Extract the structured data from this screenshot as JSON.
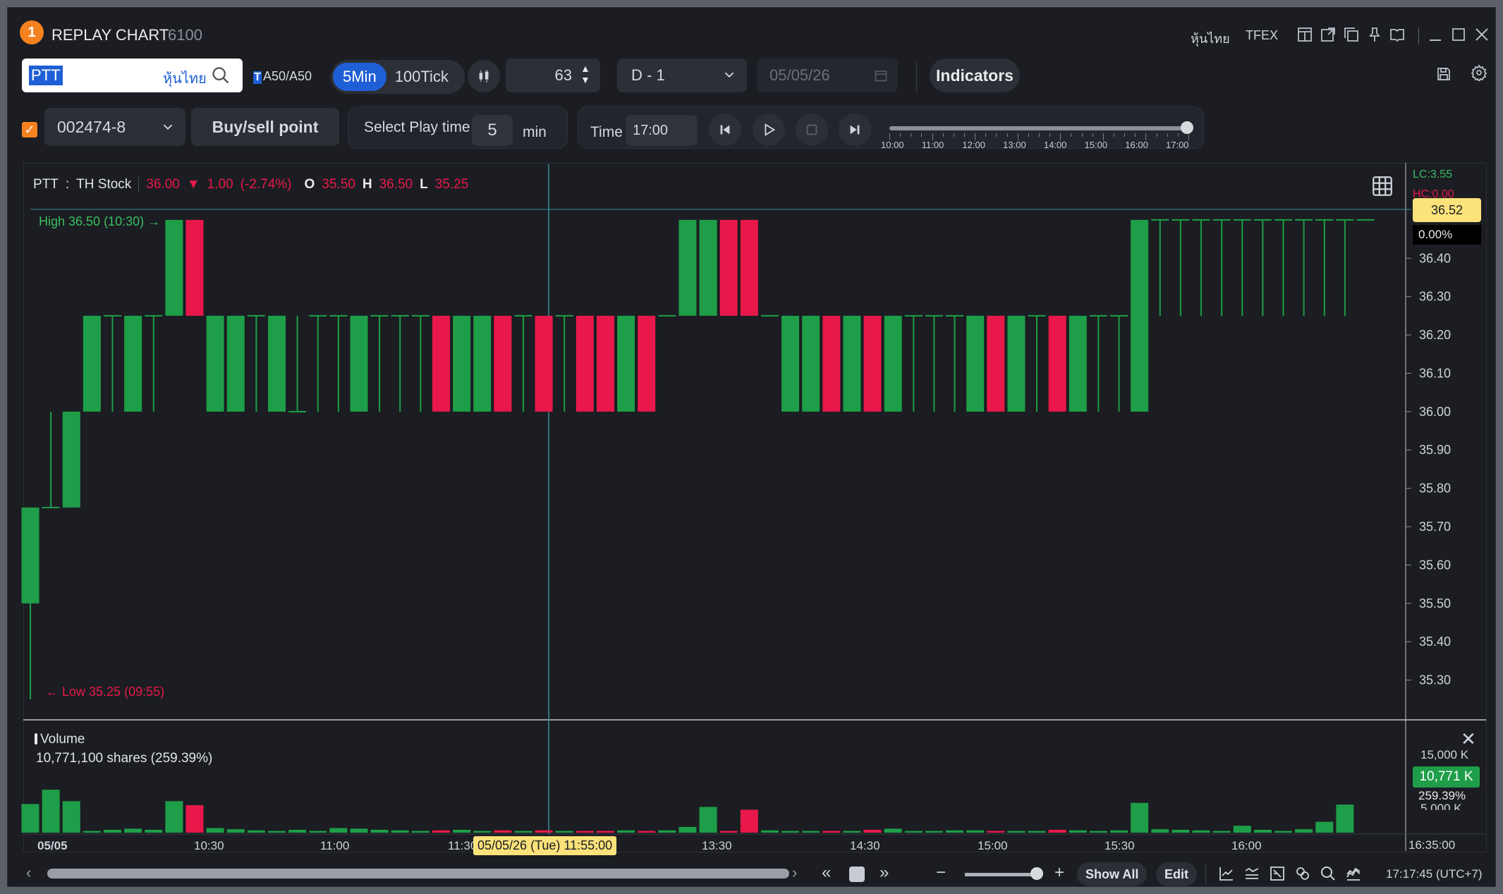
{
  "window": {
    "badge": "1",
    "title": "REPLAY CHART",
    "code": "6100",
    "links": [
      "หุ้นไทย",
      "TFEX"
    ]
  },
  "toolbar": {
    "search_value": "PTT",
    "market": "หุ้นไทย",
    "tag_t": "T",
    "tag_text": "A50/A50",
    "interval_active": "5Min",
    "interval_other": "100Tick",
    "count": "63",
    "day": "D - 1",
    "date": "05/05/26",
    "indicators": "Indicators"
  },
  "row2": {
    "account": "002474-8",
    "buy_sell": "Buy/sell point",
    "play_label": "Select Play time",
    "play_value": "5",
    "play_unit": "min",
    "time_label": "Time",
    "time_value": "17:00",
    "slider_value": "17:00",
    "slider_labels": [
      "10:00",
      "11:00",
      "12:00",
      "13:00",
      "14:00",
      "15:00",
      "16:00",
      "17:00"
    ]
  },
  "info": {
    "symbol": "PTT",
    "colon": ":",
    "market": "TH Stock",
    "last": "36.00",
    "arrow": "▼",
    "change": "1.00",
    "pct": "(-2.74%)",
    "o_label": "O",
    "o": "35.50",
    "h_label": "H",
    "h": "36.50",
    "l_label": "L",
    "l": "35.25"
  },
  "price_panel": {
    "lc": "LC:3.55",
    "hc": "HC:0.00",
    "last_price": "36.52",
    "pct": "0.00%",
    "high_label": "High 36.50 (10:30)",
    "low_label": "Low 35.25 (09:55)",
    "y_ticks": [
      "36.40",
      "36.30",
      "36.20",
      "36.10",
      "36.00",
      "35.90",
      "35.80",
      "35.70",
      "35.60",
      "35.50",
      "35.40",
      "35.30"
    ]
  },
  "volume_panel": {
    "title": "Volume",
    "line": "10,771,100 shares (259.39%)",
    "y_tick": "15,000 K",
    "y_tick_partial": "5,000 K",
    "badge": "10,771 K",
    "pct": "259.39%",
    "close": "✕"
  },
  "x_axis": {
    "labels": [
      "05/05",
      "10:30",
      "11:00",
      "11:30",
      "13:30",
      "14:30",
      "15:00",
      "15:30",
      "16:00"
    ],
    "tooltip": "05/05/26 (Tue) 11:55:00",
    "right_label": "16:35:00"
  },
  "bottombar": {
    "prev": "«",
    "next": "»",
    "minus": "−",
    "plus": "+",
    "show_all": "Show All",
    "edit": "Edit",
    "clock": "17:17:45 (UTC+7)"
  },
  "colors": {
    "up": "#1e9e48",
    "down": "#e8194a",
    "accent": "#1f5fd6",
    "badge": "#f58220",
    "highlight": "#fbe27a"
  },
  "chart_data": {
    "type": "candlestick",
    "ylim": [
      35.2,
      36.52
    ],
    "candles": [
      {
        "t": "09:55",
        "o": 35.5,
        "h": 35.75,
        "l": 35.25,
        "c": 35.75
      },
      {
        "t": "10:00",
        "o": 35.75,
        "h": 36.0,
        "l": 35.75,
        "c": 35.75
      },
      {
        "t": "10:05",
        "o": 35.75,
        "h": 36.0,
        "l": 35.75,
        "c": 36.0
      },
      {
        "t": "10:10",
        "o": 36.0,
        "h": 36.25,
        "l": 36.0,
        "c": 36.25
      },
      {
        "t": "10:15",
        "o": 36.25,
        "h": 36.25,
        "l": 36.0,
        "c": 36.25
      },
      {
        "t": "10:20",
        "o": 36.0,
        "h": 36.25,
        "l": 36.0,
        "c": 36.25
      },
      {
        "t": "10:25",
        "o": 36.25,
        "h": 36.25,
        "l": 36.0,
        "c": 36.25
      },
      {
        "t": "10:30",
        "o": 36.25,
        "h": 36.5,
        "l": 36.25,
        "c": 36.5
      },
      {
        "t": "10:35",
        "o": 36.5,
        "h": 36.5,
        "l": 36.25,
        "c": 36.25
      },
      {
        "t": "10:40",
        "o": 36.0,
        "h": 36.25,
        "l": 36.0,
        "c": 36.25
      },
      {
        "t": "10:45",
        "o": 36.0,
        "h": 36.25,
        "l": 36.0,
        "c": 36.25
      },
      {
        "t": "10:50",
        "o": 36.25,
        "h": 36.25,
        "l": 36.0,
        "c": 36.25
      },
      {
        "t": "10:55",
        "o": 36.0,
        "h": 36.25,
        "l": 36.0,
        "c": 36.25
      },
      {
        "t": "11:00",
        "o": 36.0,
        "h": 36.25,
        "l": 36.0,
        "c": 36.0
      },
      {
        "t": "11:05",
        "o": 36.25,
        "h": 36.25,
        "l": 36.0,
        "c": 36.25
      },
      {
        "t": "11:10",
        "o": 36.25,
        "h": 36.25,
        "l": 36.0,
        "c": 36.25
      },
      {
        "t": "11:15",
        "o": 36.0,
        "h": 36.25,
        "l": 36.0,
        "c": 36.25
      },
      {
        "t": "11:20",
        "o": 36.25,
        "h": 36.25,
        "l": 36.0,
        "c": 36.25
      },
      {
        "t": "11:25",
        "o": 36.25,
        "h": 36.25,
        "l": 36.0,
        "c": 36.25
      },
      {
        "t": "11:30",
        "o": 36.25,
        "h": 36.25,
        "l": 36.0,
        "c": 36.25
      },
      {
        "t": "11:35",
        "o": 36.25,
        "h": 36.25,
        "l": 36.0,
        "c": 36.0
      },
      {
        "t": "11:40",
        "o": 36.0,
        "h": 36.25,
        "l": 36.0,
        "c": 36.25
      },
      {
        "t": "11:45",
        "o": 36.0,
        "h": 36.25,
        "l": 36.0,
        "c": 36.25
      },
      {
        "t": "11:50",
        "o": 36.25,
        "h": 36.25,
        "l": 36.0,
        "c": 36.0
      },
      {
        "t": "11:55",
        "o": 36.25,
        "h": 36.25,
        "l": 36.0,
        "c": 36.25
      },
      {
        "t": "12:00",
        "o": 36.25,
        "h": 36.25,
        "l": 36.0,
        "c": 36.0
      },
      {
        "t": "12:05",
        "o": 36.25,
        "h": 36.25,
        "l": 36.0,
        "c": 36.25
      },
      {
        "t": "12:10",
        "o": 36.25,
        "h": 36.25,
        "l": 36.0,
        "c": 36.0
      },
      {
        "t": "12:15",
        "o": 36.25,
        "h": 36.25,
        "l": 36.0,
        "c": 36.0
      },
      {
        "t": "12:20",
        "o": 36.0,
        "h": 36.25,
        "l": 36.0,
        "c": 36.25
      },
      {
        "t": "12:25",
        "o": 36.25,
        "h": 36.25,
        "l": 36.0,
        "c": 36.0
      },
      {
        "t": "12:30",
        "o": 36.25,
        "h": 36.25,
        "l": 36.25,
        "c": 36.25
      },
      {
        "t": "12:35",
        "o": 36.25,
        "h": 36.5,
        "l": 36.25,
        "c": 36.5
      },
      {
        "t": "12:40",
        "o": 36.25,
        "h": 36.5,
        "l": 36.25,
        "c": 36.5
      },
      {
        "t": "12:45",
        "o": 36.5,
        "h": 36.5,
        "l": 36.25,
        "c": 36.25
      },
      {
        "t": "12:50",
        "o": 36.5,
        "h": 36.5,
        "l": 36.25,
        "c": 36.25
      },
      {
        "t": "12:55",
        "o": 36.25,
        "h": 36.25,
        "l": 36.25,
        "c": 36.25
      },
      {
        "t": "13:00",
        "o": 36.0,
        "h": 36.25,
        "l": 36.0,
        "c": 36.25
      },
      {
        "t": "13:05",
        "o": 36.0,
        "h": 36.25,
        "l": 36.0,
        "c": 36.25
      },
      {
        "t": "13:10",
        "o": 36.25,
        "h": 36.25,
        "l": 36.0,
        "c": 36.0
      },
      {
        "t": "13:15",
        "o": 36.0,
        "h": 36.25,
        "l": 36.0,
        "c": 36.25
      },
      {
        "t": "13:20",
        "o": 36.25,
        "h": 36.25,
        "l": 36.0,
        "c": 36.0
      },
      {
        "t": "13:25",
        "o": 36.0,
        "h": 36.25,
        "l": 36.0,
        "c": 36.25
      },
      {
        "t": "13:30",
        "o": 36.25,
        "h": 36.25,
        "l": 36.0,
        "c": 36.25
      },
      {
        "t": "13:35",
        "o": 36.25,
        "h": 36.25,
        "l": 36.0,
        "c": 36.25
      },
      {
        "t": "13:40",
        "o": 36.25,
        "h": 36.25,
        "l": 36.0,
        "c": 36.25
      },
      {
        "t": "13:45",
        "o": 36.0,
        "h": 36.25,
        "l": 36.0,
        "c": 36.25
      },
      {
        "t": "13:50",
        "o": 36.25,
        "h": 36.25,
        "l": 36.0,
        "c": 36.0
      },
      {
        "t": "13:55",
        "o": 36.0,
        "h": 36.25,
        "l": 36.0,
        "c": 36.25
      },
      {
        "t": "14:00",
        "o": 36.25,
        "h": 36.25,
        "l": 36.0,
        "c": 36.25
      },
      {
        "t": "14:05",
        "o": 36.25,
        "h": 36.25,
        "l": 36.0,
        "c": 36.0
      },
      {
        "t": "14:10",
        "o": 36.0,
        "h": 36.25,
        "l": 36.0,
        "c": 36.25
      },
      {
        "t": "14:15",
        "o": 36.25,
        "h": 36.25,
        "l": 36.0,
        "c": 36.25
      },
      {
        "t": "14:20",
        "o": 36.25,
        "h": 36.25,
        "l": 36.0,
        "c": 36.25
      },
      {
        "t": "14:25",
        "o": 36.0,
        "h": 36.5,
        "l": 36.0,
        "c": 36.5
      },
      {
        "t": "14:30",
        "o": 36.5,
        "h": 36.5,
        "l": 36.25,
        "c": 36.5
      },
      {
        "t": "14:35",
        "o": 36.5,
        "h": 36.5,
        "l": 36.25,
        "c": 36.5
      },
      {
        "t": "14:40",
        "o": 36.5,
        "h": 36.5,
        "l": 36.25,
        "c": 36.5
      },
      {
        "t": "14:45",
        "o": 36.5,
        "h": 36.5,
        "l": 36.25,
        "c": 36.5
      },
      {
        "t": "14:50",
        "o": 36.5,
        "h": 36.5,
        "l": 36.25,
        "c": 36.5
      },
      {
        "t": "14:55",
        "o": 36.5,
        "h": 36.5,
        "l": 36.25,
        "c": 36.5
      },
      {
        "t": "15:00",
        "o": 36.5,
        "h": 36.5,
        "l": 36.25,
        "c": 36.5
      },
      {
        "t": "15:05",
        "o": 36.5,
        "h": 36.5,
        "l": 36.25,
        "c": 36.5
      },
      {
        "t": "15:10",
        "o": 36.5,
        "h": 36.5,
        "l": 36.25,
        "c": 36.5
      },
      {
        "t": "15:15",
        "o": 36.5,
        "h": 36.5,
        "l": 36.25,
        "c": 36.5
      },
      {
        "t": "15:20",
        "o": 36.5,
        "h": 36.5,
        "l": 36.5,
        "c": 36.5
      }
    ],
    "volume_ylim": [
      0,
      16000
    ],
    "volume_k": [
      5000,
      7500,
      5500,
      300,
      500,
      700,
      500,
      5500,
      4800,
      800,
      600,
      400,
      300,
      500,
      300,
      800,
      700,
      500,
      400,
      300,
      400,
      500,
      300,
      400,
      300,
      400,
      300,
      300,
      300,
      400,
      300,
      400,
      1000,
      4500,
      300,
      4000,
      400,
      300,
      300,
      300,
      300,
      500,
      700,
      300,
      300,
      400,
      400,
      300,
      300,
      300,
      500,
      400,
      300,
      400,
      5200,
      600,
      500,
      400,
      300,
      1200,
      500,
      300,
      600,
      1900,
      4900
    ]
  }
}
